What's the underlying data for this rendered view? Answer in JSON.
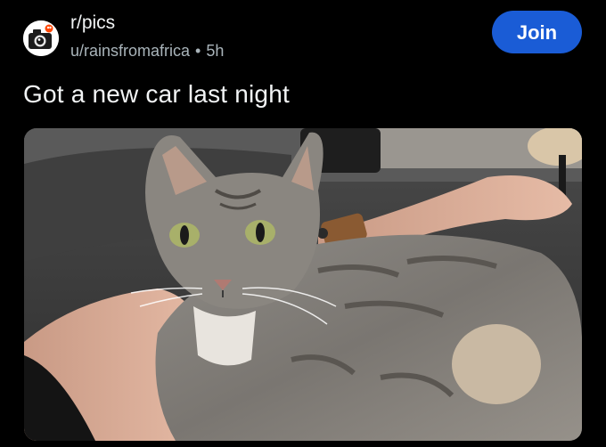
{
  "post": {
    "subreddit": "r/pics",
    "author": "u/rainsfromafrica",
    "separator": "•",
    "age": "5h",
    "title": "Got a new car last night",
    "join_label": "Join"
  },
  "media": {
    "subject": "tabby cat lying on a couch next to a person's arm"
  },
  "colors": {
    "background": "#000000",
    "join_button": "#1a5cd6",
    "meta_text": "#a9b4ba"
  }
}
